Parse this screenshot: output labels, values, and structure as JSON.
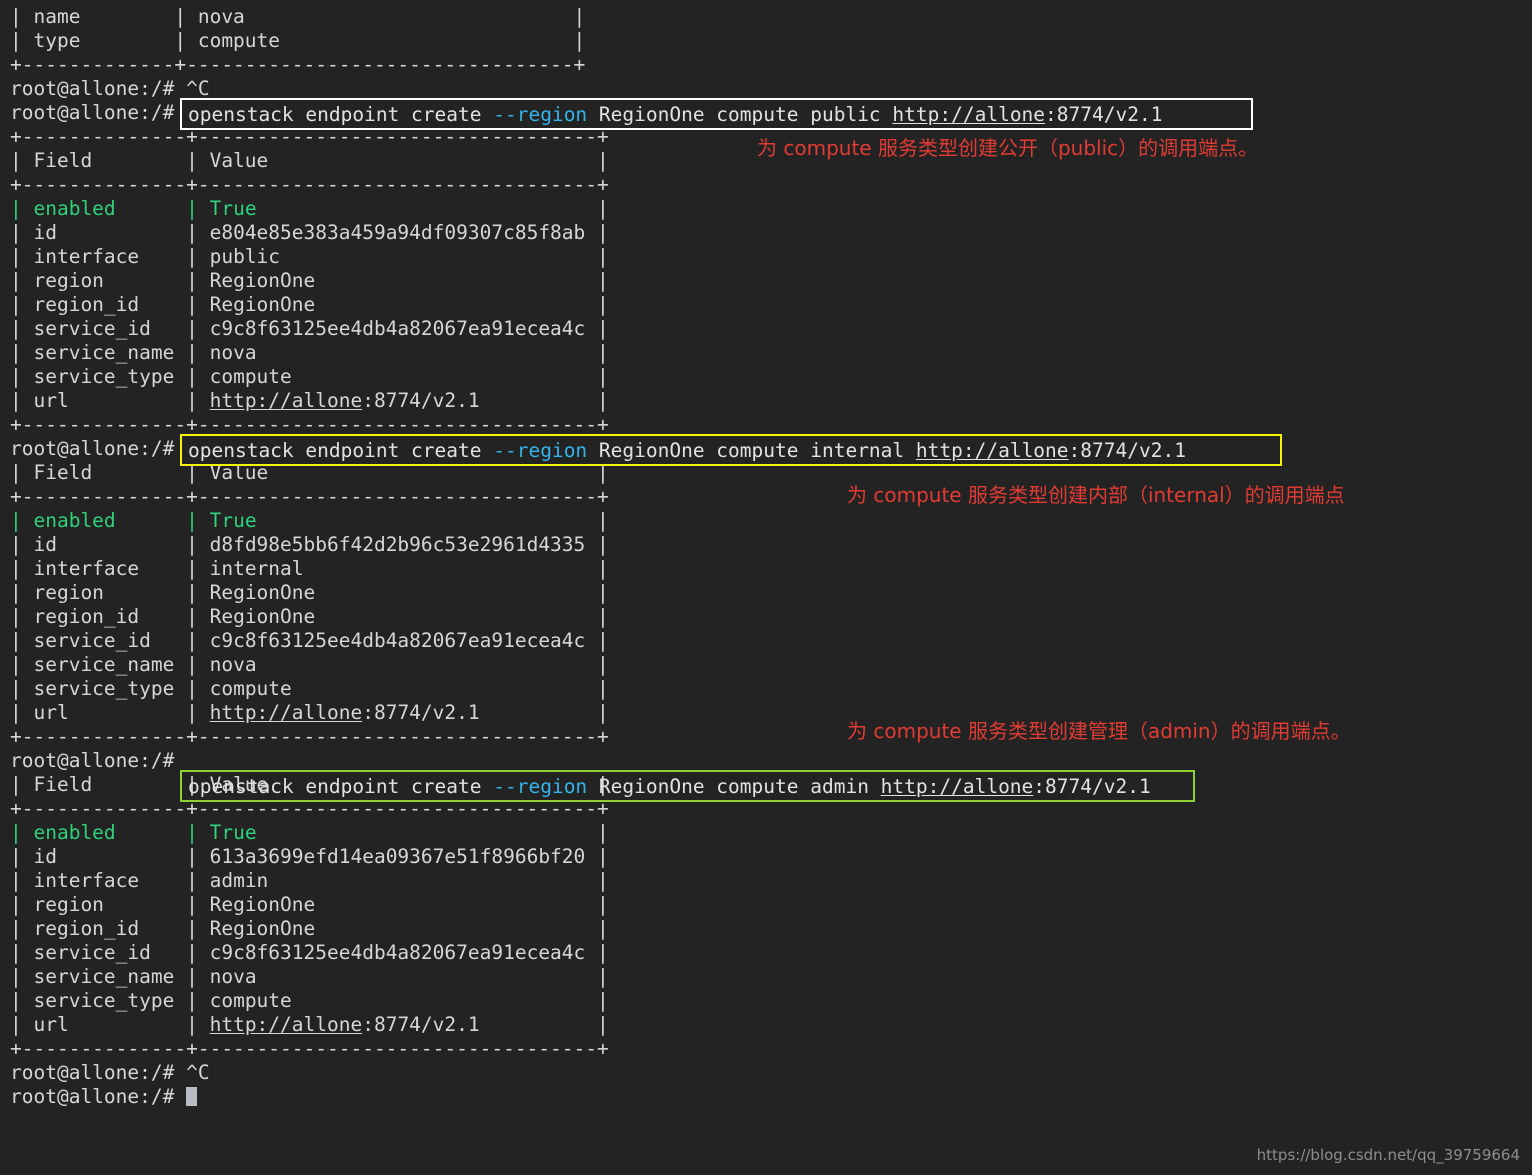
{
  "terminal": {
    "background": "#232323",
    "foreground": "#d6d6d6",
    "prompt": "root@allone:/# ",
    "interrupt": "^C",
    "colors": {
      "green": "#31d07b",
      "cyan": "#35b3e8",
      "annotation_red": "#e13b33",
      "box_white": "#ffffff",
      "box_yellow": "#f4f400",
      "box_green": "#8fd131"
    }
  },
  "top_fragment": {
    "rows": [
      {
        "field": "name",
        "value": "nova"
      },
      {
        "field": "type",
        "value": "compute"
      }
    ],
    "separator": "+-------------+---------------------------------+",
    "row_name": "| name        | nova                            |",
    "row_type": "| type        | compute                         |"
  },
  "commands": [
    {
      "id": "public",
      "prompt": "root@allone:/# ",
      "prefix": "openstack endpoint create ",
      "flag": "--region",
      "suffix": " RegionOne compute public ",
      "url_link": "http://allone",
      "url_rest": ":8774/v2.1",
      "full": "openstack endpoint create --region RegionOne compute public http://allone:8774/v2.1",
      "box_color": "#ffffff"
    },
    {
      "id": "internal",
      "prompt": "root@allone:/# ",
      "prefix": "openstack endpoint create ",
      "flag": "--region",
      "suffix": " RegionOne compute internal ",
      "url_link": "http://allone",
      "url_rest": ":8774/v2.1",
      "full": "openstack endpoint create --region RegionOne compute internal http://allone:8774/v2.1",
      "box_color": "#f4f400"
    },
    {
      "id": "admin",
      "prompt": "root@allone:/# ",
      "prefix": "openstack endpoint create ",
      "flag": "--region",
      "suffix": " RegionOne compute admin ",
      "url_link": "http://allone",
      "url_rest": ":8774/v2.1",
      "full": "openstack endpoint create --region RegionOne compute admin http://allone:8774/v2.1",
      "box_color": "#8fd131"
    }
  ],
  "annotations": [
    {
      "id": "public",
      "text": "为 compute 服务类型创建公开（public）的调用端点。"
    },
    {
      "id": "internal",
      "text": "为 compute 服务类型创建内部（internal）的调用端点"
    },
    {
      "id": "admin",
      "text": "为 compute 服务类型创建管理（admin）的调用端点。"
    }
  ],
  "tables": [
    {
      "id": "public",
      "header": {
        "field": "Field",
        "value": "Value"
      },
      "separator": "+--------------+----------------------------------+",
      "header_line": "| Field        | Value                            |",
      "rows": [
        {
          "field": "enabled",
          "value": "True",
          "highlight": true
        },
        {
          "field": "id",
          "value": "e804e85e383a459a94df09307c85f8ab",
          "highlight": false
        },
        {
          "field": "interface",
          "value": "public",
          "highlight": false
        },
        {
          "field": "region",
          "value": "RegionOne",
          "highlight": false
        },
        {
          "field": "region_id",
          "value": "RegionOne",
          "highlight": false
        },
        {
          "field": "service_id",
          "value": "c9c8f63125ee4db4a82067ea91ecea4c",
          "highlight": false
        },
        {
          "field": "service_name",
          "value": "nova",
          "highlight": false
        },
        {
          "field": "service_type",
          "value": "compute",
          "highlight": false
        },
        {
          "field": "url",
          "value": "http://allone:8774/v2.1",
          "highlight": false,
          "is_url": true
        }
      ]
    },
    {
      "id": "internal",
      "header": {
        "field": "Field",
        "value": "Value"
      },
      "separator": "+--------------+----------------------------------+",
      "header_line": "| Field        | Value                            |",
      "rows": [
        {
          "field": "enabled",
          "value": "True",
          "highlight": true
        },
        {
          "field": "id",
          "value": "d8fd98e5bb6f42d2b96c53e2961d4335",
          "highlight": false
        },
        {
          "field": "interface",
          "value": "internal",
          "highlight": false
        },
        {
          "field": "region",
          "value": "RegionOne",
          "highlight": false
        },
        {
          "field": "region_id",
          "value": "RegionOne",
          "highlight": false
        },
        {
          "field": "service_id",
          "value": "c9c8f63125ee4db4a82067ea91ecea4c",
          "highlight": false
        },
        {
          "field": "service_name",
          "value": "nova",
          "highlight": false
        },
        {
          "field": "service_type",
          "value": "compute",
          "highlight": false
        },
        {
          "field": "url",
          "value": "http://allone:8774/v2.1",
          "highlight": false,
          "is_url": true
        }
      ]
    },
    {
      "id": "admin",
      "header": {
        "field": "Field",
        "value": "Value"
      },
      "separator": "+--------------+----------------------------------+",
      "header_line": "| Field        | Value                            |",
      "rows": [
        {
          "field": "enabled",
          "value": "True",
          "highlight": true
        },
        {
          "field": "id",
          "value": "613a3699efd14ea09367e51f8966bf20",
          "highlight": false
        },
        {
          "field": "interface",
          "value": "admin",
          "highlight": false
        },
        {
          "field": "region",
          "value": "RegionOne",
          "highlight": false
        },
        {
          "field": "region_id",
          "value": "RegionOne",
          "highlight": false
        },
        {
          "field": "service_id",
          "value": "c9c8f63125ee4db4a82067ea91ecea4c",
          "highlight": false
        },
        {
          "field": "service_name",
          "value": "nova",
          "highlight": false
        },
        {
          "field": "service_type",
          "value": "compute",
          "highlight": false
        },
        {
          "field": "url",
          "value": "http://allone:8774/v2.1",
          "highlight": false,
          "is_url": true
        }
      ]
    }
  ],
  "footer": {
    "interrupt_line": "root@allone:/# ^C",
    "prompt_line": "root@allone:/# "
  },
  "watermark": "https://blog.csdn.net/qq_39759664"
}
